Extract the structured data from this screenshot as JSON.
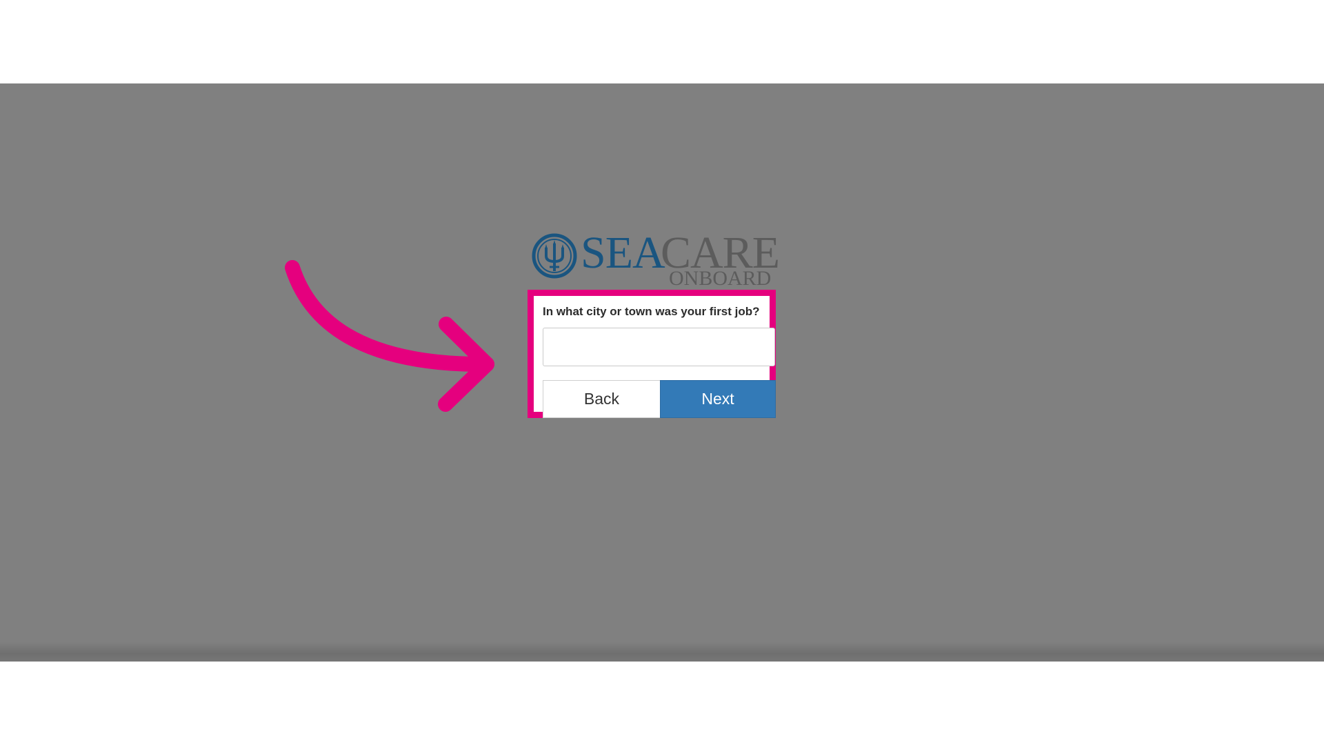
{
  "logo": {
    "sea": "SEA",
    "care": "CARE",
    "onboard": "ONBOARD",
    "emblem_icon": "trident-emblem-icon",
    "colors": {
      "sea": "#1a5580",
      "care": "#5c5c5c"
    }
  },
  "security_question": {
    "prompt": "In what city or town was your first job?",
    "answer_value": "",
    "answer_placeholder": ""
  },
  "buttons": {
    "back_label": "Back",
    "next_label": "Next"
  },
  "annotation": {
    "highlight_color": "#e5007e",
    "arrow_icon": "curved-arrow-icon"
  },
  "colors": {
    "overlay": "#808080",
    "primary_button": "#337ab7"
  }
}
